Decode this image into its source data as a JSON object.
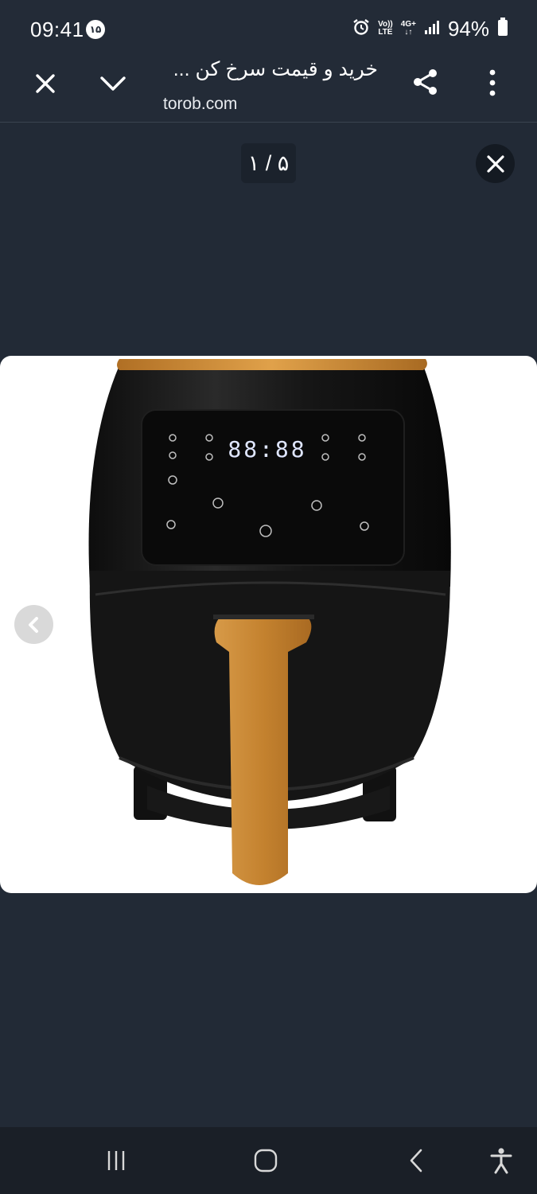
{
  "status_bar": {
    "time": "09:41",
    "notification_badge": "۱۵",
    "volte_line1": "Vo))",
    "volte_line2": "LTE",
    "network_line1": "4G+",
    "network_line2": "↓↑",
    "battery": "94%"
  },
  "browser": {
    "title": "خرید و قیمت سرخ کن ...",
    "domain": "torob.com"
  },
  "viewer": {
    "counter": "۱ / ۵",
    "display_digits": "88:88"
  },
  "colors": {
    "background": "#222a36",
    "accent_gold": "#c98a3a",
    "fryer_body": "#141414"
  }
}
